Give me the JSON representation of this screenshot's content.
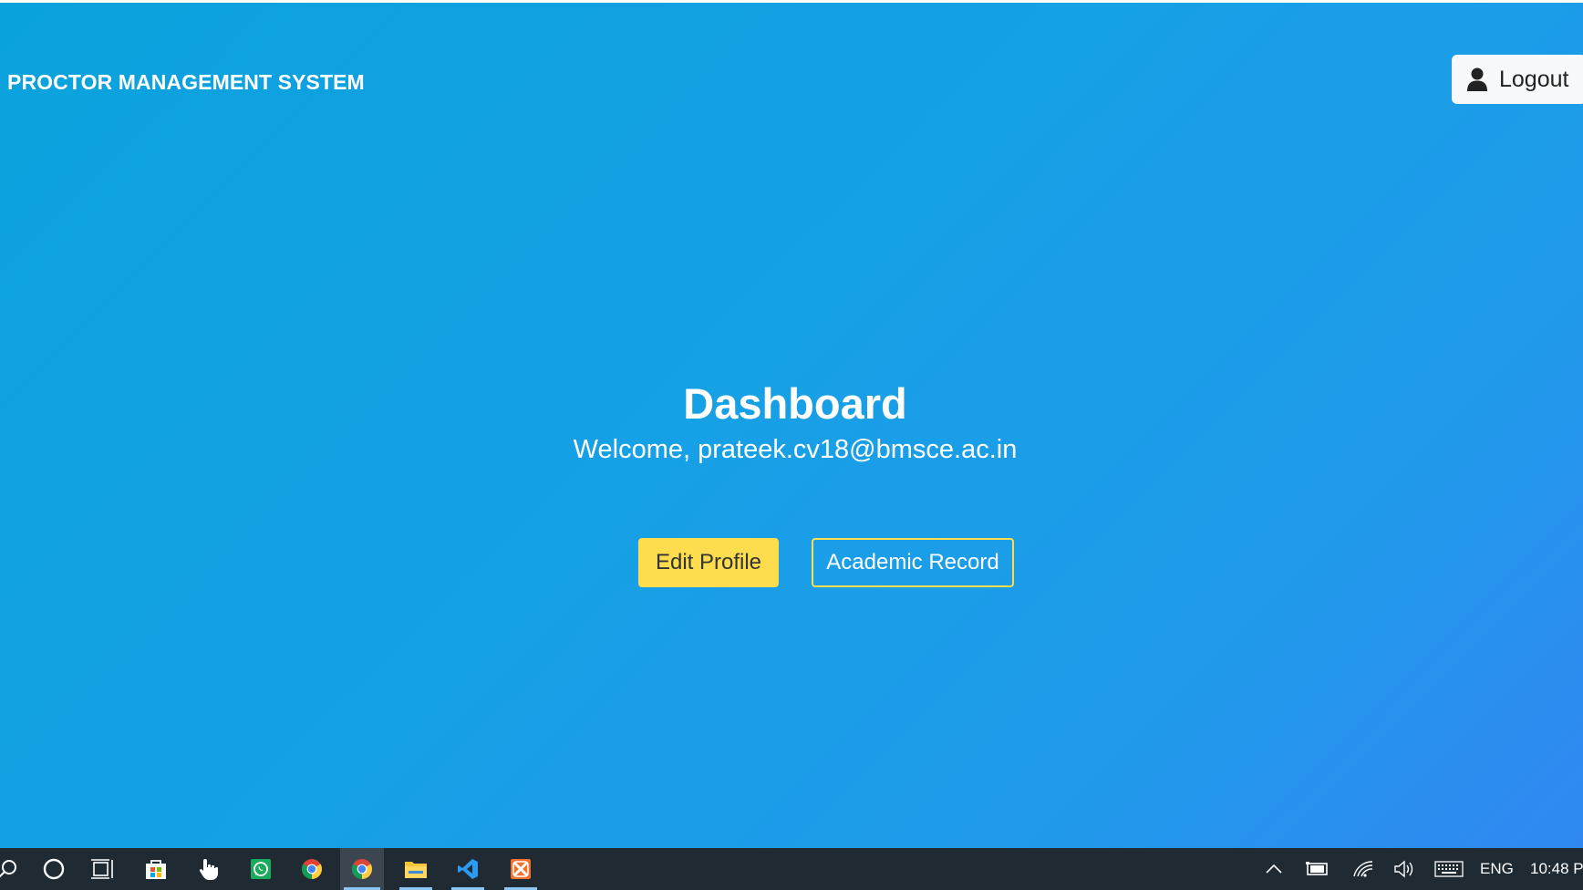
{
  "app": {
    "brand": "PROCTOR MANAGEMENT SYSTEM",
    "logout_label": "Logout"
  },
  "dashboard": {
    "title": "Dashboard",
    "welcome": "Welcome, prateek.cv18@bmsce.ac.in",
    "edit_profile_label": "Edit Profile",
    "academic_record_label": "Academic Record"
  },
  "colors": {
    "background_start": "#0aa2dd",
    "background_end": "#3187f2",
    "accent_yellow": "#fddc4e",
    "taskbar": "#1f2a33"
  },
  "taskbar": {
    "apps": [
      {
        "name": "search-icon"
      },
      {
        "name": "cortana-icon"
      },
      {
        "name": "task-view-icon"
      },
      {
        "name": "microsoft-store-icon"
      },
      {
        "name": "pointer-app-icon"
      },
      {
        "name": "whatsapp-icon"
      },
      {
        "name": "chrome-icon"
      },
      {
        "name": "chrome-icon",
        "active": true
      },
      {
        "name": "file-explorer-icon",
        "running": true
      },
      {
        "name": "vscode-icon",
        "running": true
      },
      {
        "name": "xampp-icon",
        "running": true
      }
    ],
    "tray": {
      "language": "ENG",
      "time": "10:48 P"
    }
  }
}
